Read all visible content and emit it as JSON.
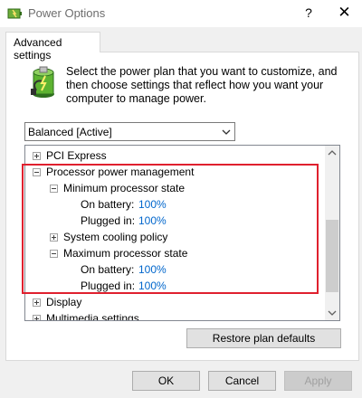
{
  "window": {
    "title": "Power Options",
    "help_glyph": "?",
    "close_glyph": "✕"
  },
  "tabs": [
    {
      "label": "Advanced settings",
      "selected": true
    }
  ],
  "description": "Select the power plan that you want to customize, and then choose settings that reflect how you want your computer to manage power.",
  "plan_select": {
    "value": "Balanced [Active]"
  },
  "tree": {
    "items": [
      {
        "label": "PCI Express",
        "expanded": false
      },
      {
        "label": "Processor power management",
        "expanded": true
      },
      {
        "label": "Minimum processor state",
        "expanded": true
      },
      {
        "label": "On battery:",
        "value": "100%"
      },
      {
        "label": "Plugged in:",
        "value": "100%"
      },
      {
        "label": "System cooling policy",
        "expanded": false
      },
      {
        "label": "Maximum processor state",
        "expanded": true
      },
      {
        "label": "On battery:",
        "value": "100%"
      },
      {
        "label": "Plugged in:",
        "value": "100%"
      },
      {
        "label": "Display",
        "expanded": false
      },
      {
        "label": "Multimedia settings",
        "expanded": false
      }
    ]
  },
  "buttons": {
    "restore": "Restore plan defaults",
    "ok": "OK",
    "cancel": "Cancel",
    "apply": "Apply"
  },
  "colors": {
    "highlight": "#e0202e",
    "value_link": "#0066cc"
  }
}
